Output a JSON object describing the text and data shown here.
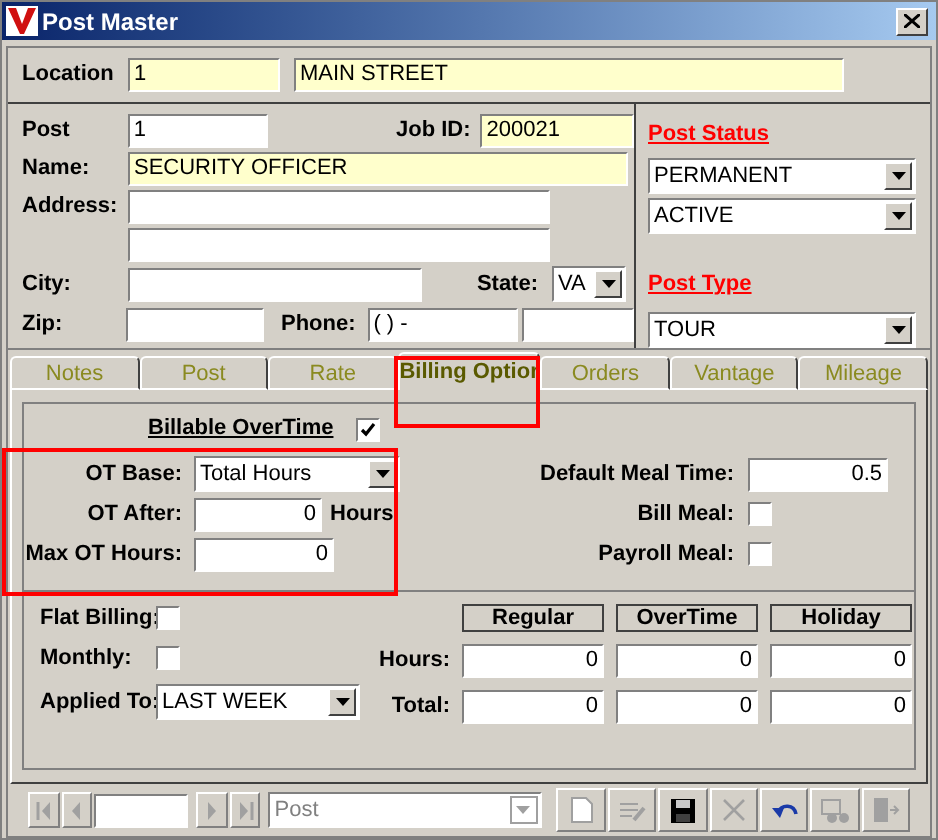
{
  "window": {
    "title": "Post Master"
  },
  "location": {
    "label": "Location",
    "code": "1",
    "name": "MAIN STREET"
  },
  "post": {
    "post_label": "Post",
    "post_value": "1",
    "job_label": "Job ID:",
    "job_value": "200021",
    "name_label": "Name:",
    "name_value": "SECURITY OFFICER",
    "address_label": "Address:",
    "city_label": "City:",
    "state_label": "State:",
    "state_value": "VA",
    "zip_label": "Zip:",
    "phone_label": "Phone:",
    "phone_value": "(   )    -"
  },
  "status": {
    "status_title": "Post Status",
    "status_values": [
      "PERMANENT",
      "ACTIVE"
    ],
    "type_title": "Post Type",
    "type_value": "TOUR"
  },
  "tabs": [
    {
      "label": "Notes",
      "selected": false
    },
    {
      "label": "Post",
      "selected": false
    },
    {
      "label": "Rate",
      "selected": false
    },
    {
      "label": "Billing Optior",
      "selected": true
    },
    {
      "label": "Orders",
      "selected": false
    },
    {
      "label": "Vantage",
      "selected": false
    },
    {
      "label": "Mileage",
      "selected": false
    }
  ],
  "billing": {
    "billable_overtime": {
      "label": "Billable OverTime",
      "checked": true
    },
    "ot_base": {
      "label": "OT Base:",
      "value": "Total Hours"
    },
    "ot_after": {
      "label": "OT After:",
      "value": "0",
      "unit": "Hours"
    },
    "max_ot_hours": {
      "label": "Max OT Hours:",
      "value": "0"
    },
    "default_meal_time": {
      "label": "Default Meal Time:",
      "value": "0.5"
    },
    "bill_meal": {
      "label": "Bill Meal:",
      "checked": false
    },
    "payroll_meal": {
      "label": "Payroll Meal:",
      "checked": false
    },
    "flat_billing": {
      "label": "Flat Billing:",
      "checked": false
    },
    "monthly": {
      "label": "Monthly:",
      "checked": false
    },
    "applied_to": {
      "label": "Applied To:",
      "value": "LAST WEEK"
    },
    "columns": [
      "Regular",
      "OverTime",
      "Holiday"
    ],
    "rows": [
      {
        "label": "Hours:",
        "values": [
          "0",
          "0",
          "0"
        ]
      },
      {
        "label": "Total:",
        "values": [
          "0",
          "0",
          "0"
        ]
      }
    ]
  },
  "toolbar": {
    "record_combo": "Post",
    "buttons": [
      {
        "kind": "first",
        "disabled": true
      },
      {
        "kind": "prev",
        "disabled": true
      },
      {
        "kind": "next",
        "disabled": true
      },
      {
        "kind": "last",
        "disabled": true
      },
      {
        "kind": "new",
        "disabled": true
      },
      {
        "kind": "edit",
        "disabled": true
      },
      {
        "kind": "save",
        "disabled": false
      },
      {
        "kind": "delete",
        "disabled": true
      },
      {
        "kind": "undo",
        "disabled": false
      },
      {
        "kind": "find",
        "disabled": true
      },
      {
        "kind": "exit",
        "disabled": true
      }
    ]
  }
}
